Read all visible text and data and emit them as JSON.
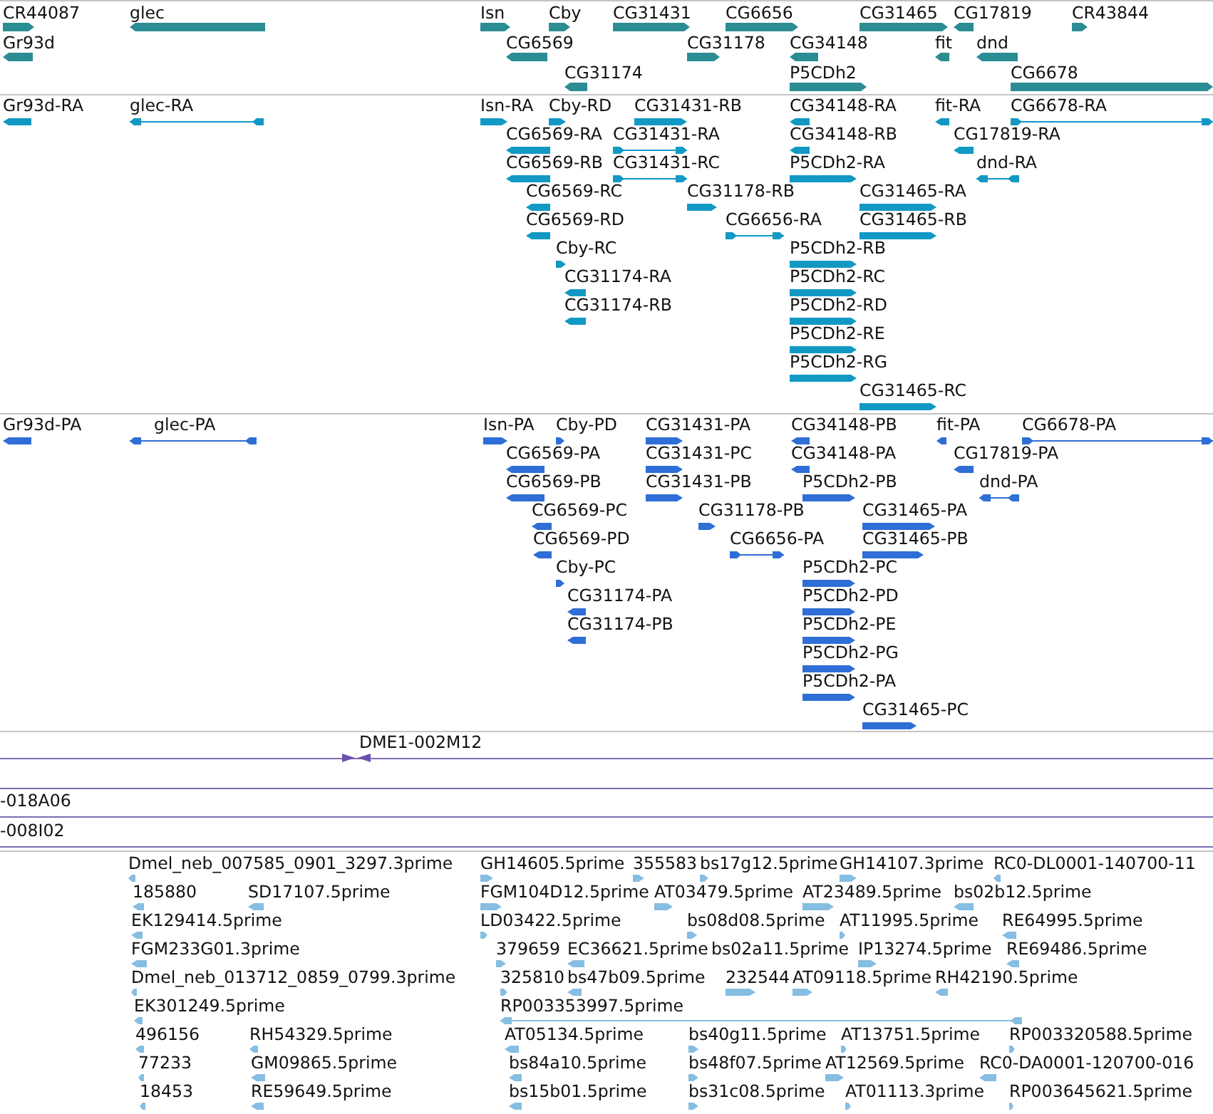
{
  "tracks": [
    {
      "kind": "gene",
      "features": [
        {
          "label": "CR44087",
          "reverse": false
        },
        {
          "label": "glec",
          "reverse": true
        },
        {
          "label": "Isn",
          "reverse": false
        },
        {
          "label": "Cby",
          "reverse": false
        },
        {
          "label": "CG31431",
          "reverse": false
        },
        {
          "label": "CG6656",
          "reverse": false
        },
        {
          "label": "CG31465",
          "reverse": false
        },
        {
          "label": "CG17819",
          "reverse": true
        },
        {
          "label": "CR43844",
          "reverse": false
        },
        {
          "label": "Gr93d",
          "reverse": true
        },
        {
          "label": "CG6569",
          "reverse": true
        },
        {
          "label": "CG31178",
          "reverse": false
        },
        {
          "label": "CG34148",
          "reverse": true
        },
        {
          "label": "fit",
          "reverse": true
        },
        {
          "label": "dnd",
          "reverse": true
        },
        {
          "label": "CG31174",
          "reverse": true
        },
        {
          "label": "P5CDh2",
          "reverse": false
        },
        {
          "label": "CG6678",
          "reverse": false
        }
      ]
    },
    {
      "kind": "transcript",
      "features": [
        {
          "label": "Gr93d-RA",
          "reverse": true
        },
        {
          "label": "glec-RA",
          "reverse": true
        },
        {
          "label": "Isn-RA",
          "reverse": false
        },
        {
          "label": "Cby-RD",
          "reverse": false
        },
        {
          "label": "CG31431-RB",
          "reverse": false
        },
        {
          "label": "CG34148-RA",
          "reverse": true
        },
        {
          "label": "fit-RA",
          "reverse": true
        },
        {
          "label": "CG6678-RA",
          "reverse": false
        },
        {
          "label": "CG6569-RA",
          "reverse": true
        },
        {
          "label": "CG31431-RA",
          "reverse": false
        },
        {
          "label": "CG34148-RB",
          "reverse": true
        },
        {
          "label": "CG17819-RA",
          "reverse": true
        },
        {
          "label": "CG6569-RB",
          "reverse": true
        },
        {
          "label": "CG31431-RC",
          "reverse": false
        },
        {
          "label": "P5CDh2-RA",
          "reverse": false
        },
        {
          "label": "dnd-RA",
          "reverse": true
        },
        {
          "label": "CG6569-RC",
          "reverse": true
        },
        {
          "label": "CG31178-RB",
          "reverse": false
        },
        {
          "label": "CG31465-RA",
          "reverse": false
        },
        {
          "label": "CG6569-RD",
          "reverse": true
        },
        {
          "label": "CG6656-RA",
          "reverse": false
        },
        {
          "label": "CG31465-RB",
          "reverse": false
        },
        {
          "label": "Cby-RC",
          "reverse": false
        },
        {
          "label": "P5CDh2-RB",
          "reverse": false
        },
        {
          "label": "CG31174-RA",
          "reverse": true
        },
        {
          "label": "P5CDh2-RC",
          "reverse": false
        },
        {
          "label": "CG31174-RB",
          "reverse": true
        },
        {
          "label": "P5CDh2-RD",
          "reverse": false
        },
        {
          "label": "P5CDh2-RE",
          "reverse": false
        },
        {
          "label": "P5CDh2-RG",
          "reverse": false
        },
        {
          "label": "CG31465-RC",
          "reverse": false
        }
      ]
    },
    {
      "kind": "protein",
      "features": [
        {
          "label": "Gr93d-PA",
          "reverse": true
        },
        {
          "label": "glec-PA",
          "reverse": true
        },
        {
          "label": "Isn-PA",
          "reverse": false
        },
        {
          "label": "Cby-PD",
          "reverse": false
        },
        {
          "label": "CG31431-PA",
          "reverse": false
        },
        {
          "label": "CG34148-PB",
          "reverse": true
        },
        {
          "label": "fit-PA",
          "reverse": true
        },
        {
          "label": "CG6678-PA",
          "reverse": false
        },
        {
          "label": "CG6569-PA",
          "reverse": true
        },
        {
          "label": "CG31431-PC",
          "reverse": false
        },
        {
          "label": "CG34148-PA",
          "reverse": true
        },
        {
          "label": "CG17819-PA",
          "reverse": true
        },
        {
          "label": "CG6569-PB",
          "reverse": true
        },
        {
          "label": "CG31431-PB",
          "reverse": false
        },
        {
          "label": "P5CDh2-PB",
          "reverse": false
        },
        {
          "label": "dnd-PA",
          "reverse": true
        },
        {
          "label": "CG6569-PC",
          "reverse": true
        },
        {
          "label": "CG31178-PB",
          "reverse": false
        },
        {
          "label": "CG31465-PA",
          "reverse": false
        },
        {
          "label": "CG6569-PD",
          "reverse": true
        },
        {
          "label": "CG6656-PA",
          "reverse": false
        },
        {
          "label": "CG31465-PB",
          "reverse": false
        },
        {
          "label": "Cby-PC",
          "reverse": false
        },
        {
          "label": "P5CDh2-PC",
          "reverse": false
        },
        {
          "label": "CG31174-PA",
          "reverse": true
        },
        {
          "label": "P5CDh2-PD",
          "reverse": false
        },
        {
          "label": "CG31174-PB",
          "reverse": true
        },
        {
          "label": "P5CDh2-PE",
          "reverse": false
        },
        {
          "label": "P5CDh2-PG",
          "reverse": false
        },
        {
          "label": "P5CDh2-PA",
          "reverse": false
        },
        {
          "label": "CG31465-PC",
          "reverse": false
        }
      ]
    },
    {
      "kind": "clone",
      "features": [
        {
          "label": "DME1-002M12"
        },
        {
          "label": "-018A06"
        },
        {
          "label": "-008I02"
        }
      ]
    },
    {
      "kind": "est",
      "features": [
        {
          "label": "Dmel_neb_007585_0901_3297.3prime",
          "reverse": true
        },
        {
          "label": "GH14605.5prime",
          "reverse": false
        },
        {
          "label": "355583",
          "reverse": false
        },
        {
          "label": "bs17g12.5prime",
          "reverse": false
        },
        {
          "label": "GH14107.3prime",
          "reverse": false
        },
        {
          "label": "RC0-DL0001-140700-11",
          "reverse": true
        },
        {
          "label": "185880",
          "reverse": true
        },
        {
          "label": "SD17107.5prime",
          "reverse": true
        },
        {
          "label": "FGM104D12.5prime",
          "reverse": false
        },
        {
          "label": "AT03479.5prime",
          "reverse": false
        },
        {
          "label": "AT23489.5prime",
          "reverse": false
        },
        {
          "label": "bs02b12.5prime",
          "reverse": true
        },
        {
          "label": "EK129414.5prime",
          "reverse": true
        },
        {
          "label": "LD03422.5prime",
          "reverse": false
        },
        {
          "label": "bs08d08.5prime",
          "reverse": false
        },
        {
          "label": "AT11995.5prime",
          "reverse": false
        },
        {
          "label": "RE64995.5prime",
          "reverse": true
        },
        {
          "label": "FGM233G01.3prime",
          "reverse": true
        },
        {
          "label": "379659",
          "reverse": false
        },
        {
          "label": "EC36621.5prime",
          "reverse": true
        },
        {
          "label": "bs02a11.5prime"
        },
        {
          "label": "IP13274.5prime",
          "reverse": false
        },
        {
          "label": "RE69486.5prime",
          "reverse": true
        },
        {
          "label": "Dmel_neb_013712_0859_0799.3prime",
          "reverse": true
        },
        {
          "label": "325810",
          "reverse": false
        },
        {
          "label": "bs47b09.5prime",
          "reverse": true
        },
        {
          "label": "232544",
          "reverse": false
        },
        {
          "label": "AT09118.5prime",
          "reverse": false
        },
        {
          "label": "RH42190.5prime",
          "reverse": true
        },
        {
          "label": "EK301249.5prime",
          "reverse": true
        },
        {
          "label": "RP003353997.5prime",
          "reverse": true
        },
        {
          "label": "496156",
          "reverse": true
        },
        {
          "label": "RH54329.5prime",
          "reverse": true
        },
        {
          "label": "AT05134.5prime",
          "reverse": true
        },
        {
          "label": "bs40g11.5prime",
          "reverse": false
        },
        {
          "label": "AT13751.5prime",
          "reverse": false
        },
        {
          "label": "RP003320588.5prime",
          "reverse": false
        },
        {
          "label": "77233",
          "reverse": true
        },
        {
          "label": "GM09865.5prime",
          "reverse": true
        },
        {
          "label": "bs84a10.5prime",
          "reverse": true
        },
        {
          "label": "bs48f07.5prime",
          "reverse": false
        },
        {
          "label": "AT12569.5prime",
          "reverse": false
        },
        {
          "label": "RC0-DA0001-120700-016",
          "reverse": true
        },
        {
          "label": "18453",
          "reverse": true
        },
        {
          "label": "RE59649.5prime",
          "reverse": true
        },
        {
          "label": "bs15b01.5prime",
          "reverse": true
        },
        {
          "label": "bs31c08.5prime",
          "reverse": false
        },
        {
          "label": "AT01113.3prime",
          "reverse": false
        },
        {
          "label": "RP003645621.5prime",
          "reverse": false
        }
      ]
    }
  ]
}
